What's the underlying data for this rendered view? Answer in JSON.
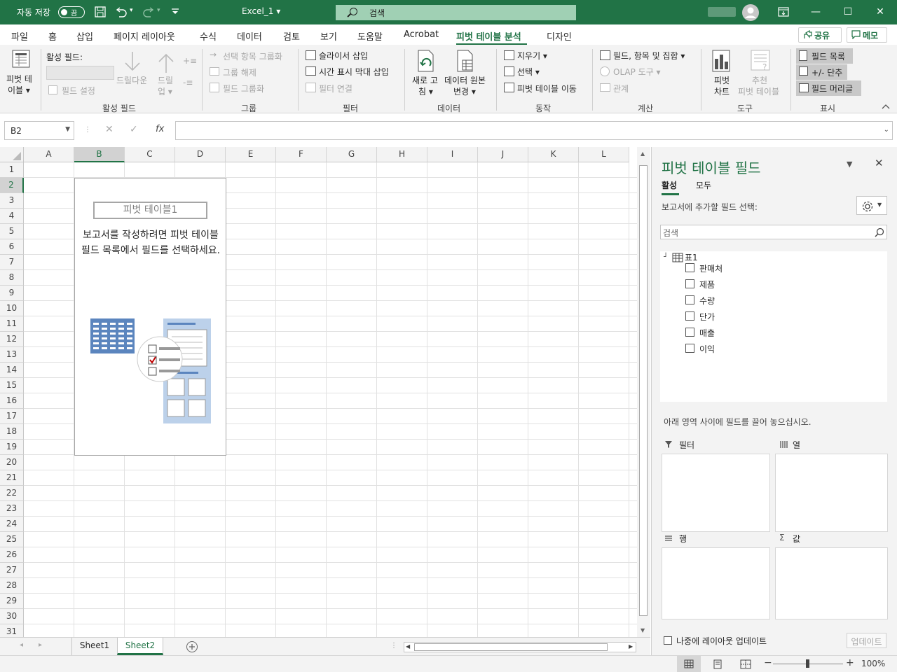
{
  "titlebar": {
    "autosave_label": "자동 저장",
    "autosave_state": "끔",
    "filename": "Excel_1 ▾",
    "search_placeholder": "검색"
  },
  "tabs": [
    "파일",
    "홈",
    "삽입",
    "페이지 레이아웃",
    "수식",
    "데이터",
    "검토",
    "보기",
    "도움말",
    "Acrobat",
    "피벗 테이블 분석",
    "디자인"
  ],
  "share_label": "공유",
  "memo_label": "메모",
  "ribbon": {
    "pivot_table_label_1": "피벗 테",
    "pivot_table_label_2": "이블 ▾",
    "active_field_label": "활성 필드:",
    "field_settings": "필드 설정",
    "drill_down": "드릴다운",
    "drill_up_1": "드릴",
    "drill_up_2": "업 ▾",
    "group_active_field": "활성 필드",
    "group_selection": "선택 항목 그룹화",
    "ungroup": "그룹 해제",
    "group_field": "필드 그룹화",
    "group_group": "그룹",
    "insert_slicer": "슬라이서 삽입",
    "insert_timeline": "시간 표시 막대 삽입",
    "filter_connections": "필터 연결",
    "group_filter": "필터",
    "refresh_1": "새로 고",
    "refresh_2": "침 ▾",
    "change_source_1": "데이터 원본",
    "change_source_2": "변경 ▾",
    "group_data": "데이터",
    "clear": "지우기 ▾",
    "select": "선택 ▾",
    "move_pivot": "피벗 테이블 이동",
    "group_actions": "동작",
    "fields_items_sets": "필드, 항목 및 집합 ▾",
    "olap_tools": "OLAP 도구 ▾",
    "relationships": "관계",
    "group_calculations": "계산",
    "pivot_chart_1": "피벗",
    "pivot_chart_2": "차트",
    "recommended_1": "추천",
    "recommended_2": "피벗 테이블",
    "group_tools": "도구",
    "field_list": "필드 목록",
    "buttons": "+/- 단추",
    "field_headers": "필드 머리글",
    "group_show": "표시"
  },
  "formula_bar": {
    "name_box": "B2",
    "fx": "fx",
    "value": ""
  },
  "grid": {
    "columns": [
      "A",
      "B",
      "C",
      "D",
      "E",
      "F",
      "G",
      "H",
      "I",
      "J",
      "K",
      "L"
    ],
    "rows": [
      "1",
      "2",
      "3",
      "4",
      "5",
      "6",
      "7",
      "8",
      "9",
      "10",
      "11",
      "12",
      "13",
      "14",
      "15",
      "16",
      "17",
      "18",
      "19",
      "20",
      "21",
      "22",
      "23",
      "24",
      "25",
      "26",
      "27",
      "28",
      "29",
      "30",
      "31"
    ],
    "selected_column": "B",
    "selected_row": "2"
  },
  "pivot_placeholder": {
    "name": "피벗 테이블1",
    "message": "보고서를 작성하려면 피벗 테이블 필드 목록에서 필드를 선택하세요."
  },
  "sheets": [
    "Sheet1",
    "Sheet2"
  ],
  "active_sheet": "Sheet2",
  "zoom": "100%",
  "task_pane": {
    "title": "피벗 테이블 필드",
    "tab_active": "활성",
    "tab_all": "모두",
    "choose_label": "보고서에 추가할 필드 선택:",
    "search_placeholder": "검색",
    "table_name": "표1",
    "fields": [
      "판매처",
      "제품",
      "수량",
      "단가",
      "매출",
      "이익"
    ],
    "drag_hint": "아래 영역 사이에 필드를 끌어 놓으십시오.",
    "area_filters": "필터",
    "area_columns": "열",
    "area_rows": "행",
    "area_values": "값",
    "defer_label": "나중에 레이아웃 업데이트",
    "update_button": "업데이트"
  },
  "colors": {
    "excel_green": "#217346",
    "ribbon_bg": "#f3f3f3"
  }
}
